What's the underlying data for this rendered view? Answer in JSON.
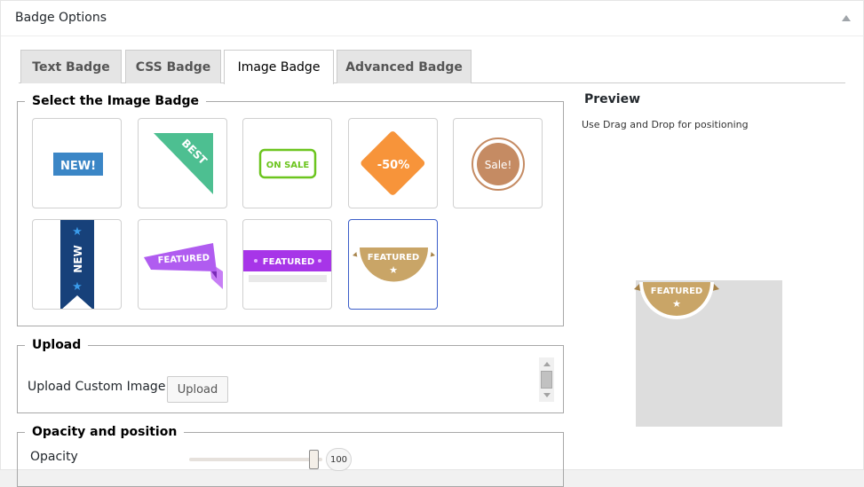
{
  "panel": {
    "title": "Badge Options"
  },
  "tabs": [
    {
      "label": "Text Badge"
    },
    {
      "label": "CSS Badge"
    },
    {
      "label": "Image Badge"
    },
    {
      "label": "Advanced Badge"
    }
  ],
  "active_tab": "Image Badge",
  "select_section": {
    "title": "Select the Image Badge",
    "badges": [
      {
        "name": "new-blue",
        "text": "NEW!",
        "color": "#3b86c6"
      },
      {
        "name": "best-corner",
        "text": "BEST",
        "color": "#4dbf91"
      },
      {
        "name": "on-sale",
        "text": "ON SALE",
        "color": "#6cc51f"
      },
      {
        "name": "percent-off",
        "text": "-50%",
        "color": "#f7943a"
      },
      {
        "name": "sale-circle",
        "text": "Sale!",
        "color": "#c58b63"
      },
      {
        "name": "new-ribbon",
        "text": "NEW",
        "color": "#17417a"
      },
      {
        "name": "featured-purple-ribbon",
        "text": "FEATURED",
        "color": "#b05cf0"
      },
      {
        "name": "featured-purple-banner",
        "text": "FEATURED",
        "color": "#a735e8"
      },
      {
        "name": "featured-gold-semicircle",
        "text": "FEATURED",
        "color": "#c9a567"
      }
    ],
    "selected_index": 8
  },
  "preview": {
    "title": "Preview",
    "hint": "Use Drag and Drop for positioning",
    "badge_text": "FEATURED",
    "background_color": "#dddddd"
  },
  "upload_section": {
    "title": "Upload",
    "label": "Upload Custom Image",
    "button": "Upload"
  },
  "opacity_section": {
    "title": "Opacity and position",
    "opacity_label": "Opacity",
    "opacity_value": "100"
  }
}
